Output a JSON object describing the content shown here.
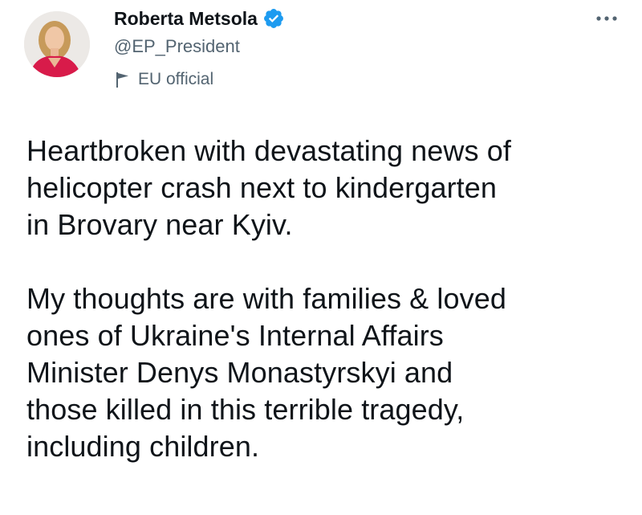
{
  "tweet": {
    "author": {
      "display_name": "Roberta Metsola",
      "handle": "@EP_President",
      "label": "EU official",
      "avatar_icon": "profile-photo",
      "verified_icon": "verified-badge-icon",
      "label_icon": "flag-icon"
    },
    "more_icon": "more-options-icon",
    "text": "Heartbroken with devastating news of\nhelicopter crash next to kindergarten\nin Brovary near Kyiv.\n\nMy thoughts are with families & loved\nones of Ukraine's Internal Affairs\nMinister Denys Monastyrskyi and\nthose killed in this terrible tragedy,\nincluding children."
  },
  "colors": {
    "text_primary": "#0f1419",
    "text_secondary": "#536471",
    "verified_blue": "#1d9bf0",
    "avatar_jacket": "#d81b4a"
  }
}
